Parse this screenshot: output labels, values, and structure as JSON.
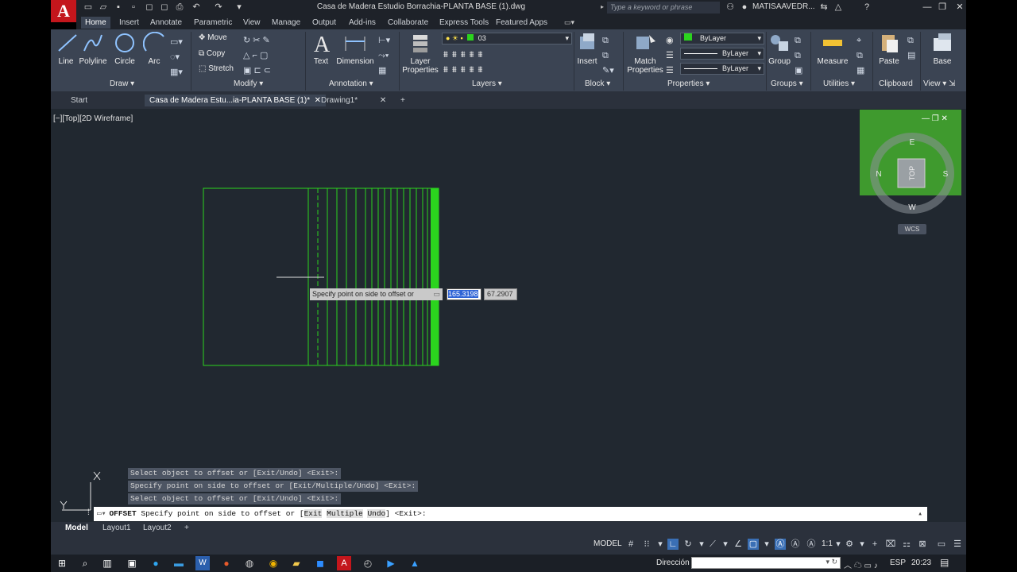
{
  "titlebar": {
    "logo": "A",
    "title": "Casa de Madera Estudio Borrachia-PLANTA BASE (1).dwg",
    "search_placeholder": "Type a keyword or phrase",
    "user": "MATISAAVEDR..."
  },
  "ribbon_tabs": [
    "Home",
    "Insert",
    "Annotate",
    "Parametric",
    "View",
    "Manage",
    "Output",
    "Add-ins",
    "Collaborate",
    "Express Tools",
    "Featured Apps"
  ],
  "ribbon": {
    "draw": {
      "title": "Draw",
      "line": "Line",
      "polyline": "Polyline",
      "circle": "Circle",
      "arc": "Arc"
    },
    "modify": {
      "title": "Modify",
      "move": "Move",
      "copy": "Copy",
      "stretch": "Stretch"
    },
    "annotation": {
      "title": "Annotation",
      "text": "Text",
      "dimension": "Dimension"
    },
    "layers": {
      "title": "Layers",
      "layer_properties_1": "Layer",
      "layer_properties_2": "Properties",
      "current_layer": "03"
    },
    "block": {
      "title": "Block",
      "insert": "Insert"
    },
    "properties": {
      "title": "Properties",
      "match_1": "Match",
      "match_2": "Properties",
      "color": "ByLayer",
      "linetype": "ByLayer",
      "lineweight": "ByLayer"
    },
    "groups": {
      "title": "Groups",
      "group": "Group"
    },
    "utilities": {
      "title": "Utilities",
      "measure": "Measure"
    },
    "clipboard": {
      "title": "Clipboard",
      "paste": "Paste"
    },
    "view": {
      "title": "View",
      "base": "Base"
    }
  },
  "doc_tabs": {
    "start": "Start",
    "active": "Casa de Madera  Estu...ia-PLANTA BASE (1)*",
    "drawing": "Drawing1*"
  },
  "viewport": {
    "label": "[−][Top][2D Wireframe]",
    "wcs": "WCS",
    "compass": {
      "top": "TOP",
      "n": "N",
      "e": "E",
      "s": "S",
      "w": "W"
    }
  },
  "dynamic_input": {
    "prompt": "Specify point on side to offset or",
    "distance": "165.3198",
    "angle": "67.2907"
  },
  "command_history": [
    "Select object to offset or [Exit/Undo] <Exit>:",
    "Specify point on side to offset or [Exit/Multiple/Undo] <Exit>:",
    "Select object to offset or [Exit/Undo] <Exit>:"
  ],
  "command_line": {
    "command": "OFFSET",
    "prompt": "Specify point on side to offset or [",
    "opt1": "Exit",
    "opt2": "Multiple",
    "opt3": "Undo",
    "tail": "] <Exit>:"
  },
  "layout_tabs": [
    "Model",
    "Layout1",
    "Layout2"
  ],
  "status": {
    "model": "MODEL",
    "scale": "1:1"
  },
  "taskbar": {
    "dir_label": "Dirección",
    "lang": "ESP",
    "time": "20:23"
  },
  "colors": {
    "accent_green": "#2bd41e",
    "canvas": "#212830",
    "ribbon": "#3b4453",
    "autocad_red": "#c4161c"
  }
}
